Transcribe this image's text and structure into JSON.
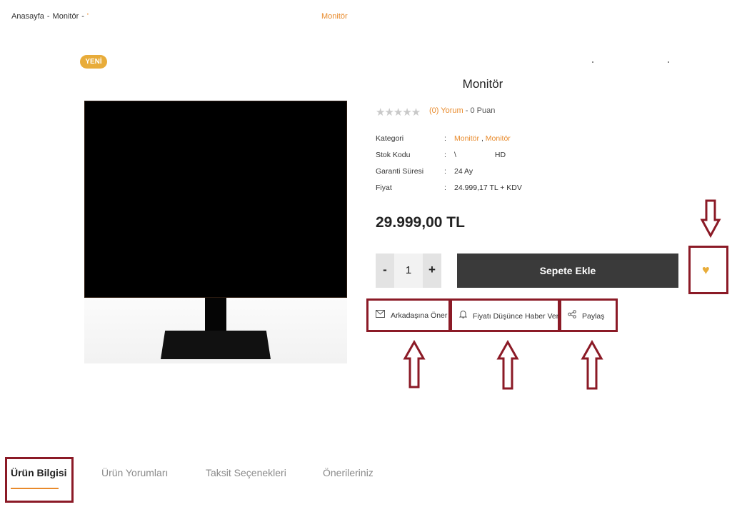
{
  "breadcrumb": {
    "home": "Anasayfa",
    "category": "Monitör",
    "separator": "-",
    "current": "'"
  },
  "breadcrumb_right": "Monitör",
  "badge": "YENİ",
  "product": {
    "title": "Monitör",
    "stars": "★★★★★",
    "review_count": "(0) Yorum",
    "points": "- 0 Puan",
    "details": {
      "category_label": "Kategori",
      "category_value_1": "Monitör",
      "category_value_2": "Monitör",
      "category_sep": ",",
      "stock_label": "Stok Kodu",
      "stock_value_prefix": "\\",
      "stock_value_suffix": "HD",
      "warranty_label": "Garanti Süresi",
      "warranty_value": "24 Ay",
      "price_label": "Fiyat",
      "price_value": "24.999,17 TL + KDV",
      "colon": ":"
    },
    "price": "29.999,00 TL"
  },
  "cart": {
    "minus": "-",
    "quantity": "1",
    "plus": "+",
    "add_label": "Sepete Ekle"
  },
  "actions": {
    "recommend": "Arkadaşına Öner",
    "price_alert": "Fiyatı Düşünce Haber Ver",
    "share": "Paylaş"
  },
  "tabs": {
    "info": "Ürün Bilgisi",
    "reviews": "Ürün Yorumları",
    "installments": "Taksit Seçenekleri",
    "suggestions": "Önerileriniz"
  },
  "colors": {
    "accent": "#e88a2b",
    "badge": "#e8ac3a",
    "annotation": "#8b1a26",
    "cart_button": "#3a3a3a"
  },
  "icons": {
    "recommend": "envelope-icon",
    "price_alert": "bell-icon",
    "share": "share-icon",
    "favorite": "heart-icon"
  }
}
